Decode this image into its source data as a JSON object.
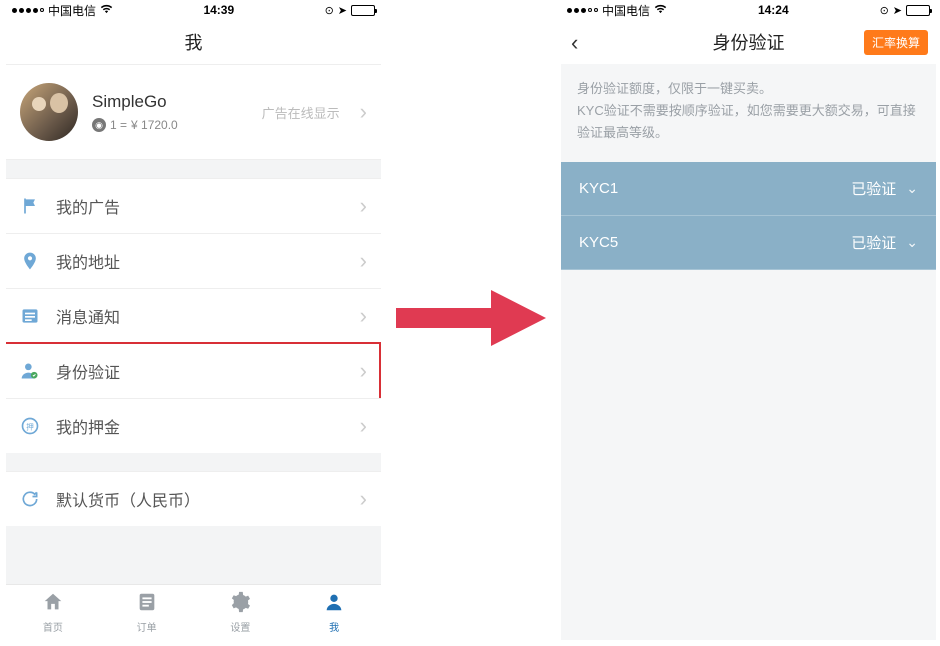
{
  "left": {
    "statusbar": {
      "carrier": "中国电信",
      "time": "14:39"
    },
    "header": {
      "title": "我"
    },
    "profile": {
      "username": "SimpleGo",
      "rate_prefix": "1 =",
      "rate_value": "¥ 1720.0",
      "ad_hint": "广告在线显示"
    },
    "menu": {
      "ads": "我的广告",
      "address": "我的地址",
      "notify": "消息通知",
      "identity": "身份验证",
      "deposit": "我的押金",
      "currency": "默认货币（人民币）"
    },
    "tabs": {
      "home": "首页",
      "orders": "订单",
      "settings": "设置",
      "me": "我"
    }
  },
  "right": {
    "statusbar": {
      "carrier": "中国电信",
      "time": "14:24"
    },
    "header": {
      "title": "身份验证",
      "pill": "汇率换算"
    },
    "note_line1": "身份验证额度，仅限于一键买卖。",
    "note_line2": "KYC验证不需要按顺序验证，如您需要更大额交易，可直接验证最高等级。",
    "rows": [
      {
        "name": "KYC1",
        "status": "已验证"
      },
      {
        "name": "KYC5",
        "status": "已验证"
      }
    ]
  }
}
